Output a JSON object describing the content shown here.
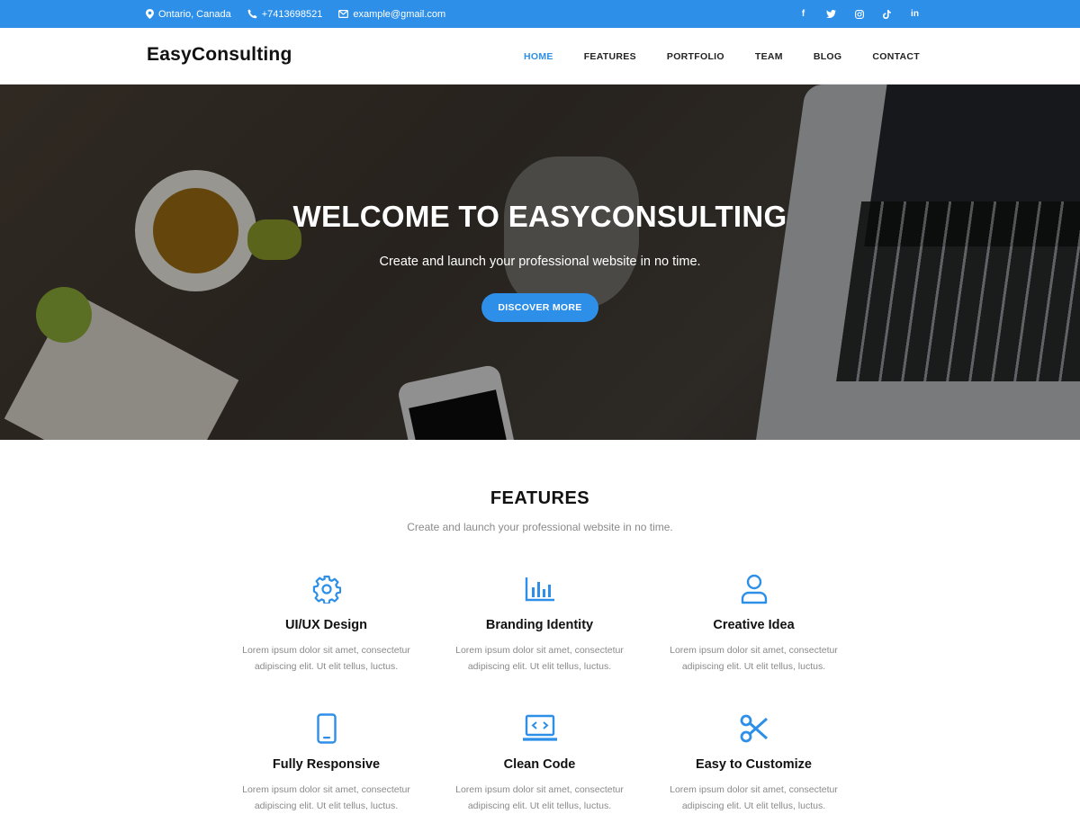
{
  "topbar": {
    "location": "Ontario, Canada",
    "phone": "+7413698521",
    "email": "example@gmail.com",
    "social": [
      "f",
      "t",
      "ig",
      "tt",
      "in"
    ]
  },
  "header": {
    "brand": "EasyConsulting",
    "nav": [
      "HOME",
      "FEATURES",
      "PORTFOLIO",
      "TEAM",
      "BLOG",
      "CONTACT"
    ],
    "active_nav": "HOME"
  },
  "hero": {
    "title": "WELCOME TO EASYCONSULTING",
    "subtitle": "Create and launch your professional website in no time.",
    "button": "DISCOVER MORE"
  },
  "features": {
    "title": "FEATURES",
    "subtitle": "Create and launch your professional website in no time.",
    "items": [
      {
        "icon": "gear-icon",
        "title": "UI/UX Design",
        "desc1": "Lorem ipsum dolor sit amet, consectetur",
        "desc2": "adipiscing elit. Ut elit tellus, luctus."
      },
      {
        "icon": "bar-chart-icon",
        "title": "Branding Identity",
        "desc1": "Lorem ipsum dolor sit amet, consectetur",
        "desc2": "adipiscing elit. Ut elit tellus, luctus."
      },
      {
        "icon": "user-icon",
        "title": "Creative Idea",
        "desc1": "Lorem ipsum dolor sit amet, consectetur",
        "desc2": "adipiscing elit. Ut elit tellus, luctus."
      },
      {
        "icon": "mobile-icon",
        "title": "Fully Responsive",
        "desc1": "Lorem ipsum dolor sit amet, consectetur",
        "desc2": "adipiscing elit. Ut elit tellus, luctus."
      },
      {
        "icon": "code-laptop-icon",
        "title": "Clean Code",
        "desc1": "Lorem ipsum dolor sit amet, consectetur",
        "desc2": "adipiscing elit. Ut elit tellus, luctus."
      },
      {
        "icon": "scissors-icon",
        "title": "Easy to Customize",
        "desc1": "Lorem ipsum dolor sit amet, consectetur",
        "desc2": "adipiscing elit. Ut elit tellus, luctus."
      }
    ]
  },
  "colors": {
    "accent": "#2d8fe8",
    "topbar": "#2d8fe8",
    "text": "#111111",
    "muted": "#8a8a8a"
  }
}
